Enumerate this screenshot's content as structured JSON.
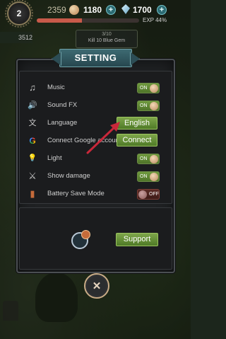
{
  "hud": {
    "level": "2",
    "gold": "2359",
    "coins": "1180",
    "gems": "1700",
    "exp_label": "EXP 44%",
    "exp_fraction": 0.44,
    "plus_symbol": "+"
  },
  "background": {
    "score": "3512",
    "quest_top": "3/10",
    "quest_text": "Kill 10 Blue Gem"
  },
  "settings": {
    "title": "SETTING",
    "rows": [
      {
        "icon": "music-note-icon",
        "glyph": "♫",
        "label": "Music",
        "control": "toggle",
        "state": "ON"
      },
      {
        "icon": "speaker-icon",
        "glyph": "🔊",
        "label": "Sound FX",
        "control": "toggle",
        "state": "ON"
      },
      {
        "icon": "translate-icon",
        "glyph": "文",
        "label": "Language",
        "control": "button",
        "value": "English"
      },
      {
        "icon": "google-icon",
        "glyph": "G",
        "label": "Connect Google account",
        "control": "button",
        "value": "Connect"
      },
      {
        "icon": "lightbulb-icon",
        "glyph": "💡",
        "label": "Light",
        "control": "toggle",
        "state": "ON"
      },
      {
        "icon": "crossed-swords-icon",
        "glyph": "⚔",
        "label": "Show damage",
        "control": "toggle",
        "state": "ON"
      },
      {
        "icon": "battery-icon",
        "glyph": "▮",
        "label": "Battery Save Mode",
        "control": "toggle",
        "state": "OFF"
      }
    ],
    "support_label": "Support",
    "close_glyph": "✕"
  },
  "colors": {
    "toggle_on": "#5e8a33",
    "toggle_off": "#4a2320",
    "button_green": "#6a9a3a",
    "header_teal": "#335c64",
    "arrow": "#c8283a"
  }
}
